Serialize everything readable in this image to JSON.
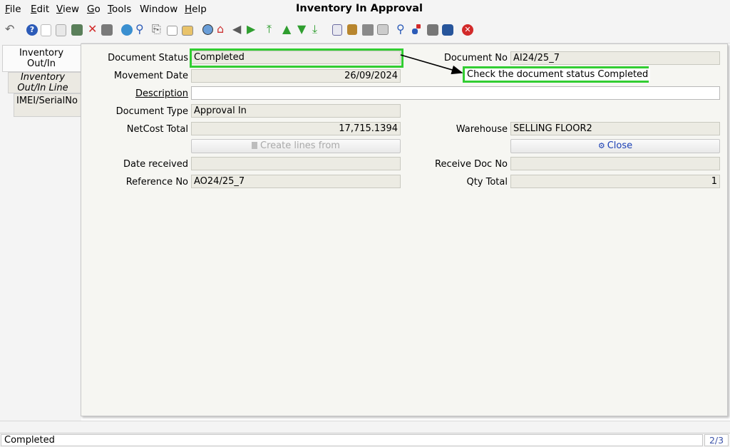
{
  "menubar": {
    "items": [
      {
        "label": "File",
        "mnemonic": "F",
        "rest": "ile"
      },
      {
        "label": "Edit",
        "mnemonic": "E",
        "rest": "dit"
      },
      {
        "label": "View",
        "mnemonic": "V",
        "rest": "iew"
      },
      {
        "label": "Go",
        "mnemonic": "G",
        "rest": "o"
      },
      {
        "label": "Tools",
        "mnemonic": "T",
        "rest": "ools"
      },
      {
        "label": "Window",
        "mnemonic": "",
        "rest": "Window"
      },
      {
        "label": "Help",
        "mnemonic": "H",
        "rest": "elp"
      }
    ],
    "title": "Inventory In Approval"
  },
  "toolbar": {
    "icons": [
      "undo-icon",
      "help-icon",
      "new-record-icon",
      "copy-record-icon",
      "delete-record-icon",
      "delete-selection-icon",
      "save-icon",
      "refresh-icon",
      "find-icon",
      "attachment-icon",
      "chat-icon",
      "multi-view-icon",
      "history-icon",
      "home-icon",
      "back-icon",
      "forward-icon",
      "first-record-icon",
      "previous-record-icon",
      "next-record-icon",
      "last-record-icon",
      "report-icon",
      "archive-icon",
      "print-icon",
      "print-preview-icon",
      "zoom-across-icon",
      "workflow-icon",
      "product-info-icon",
      "process-icon",
      "exit-icon"
    ],
    "colors": {
      "green": "#2f9e2f",
      "blue": "#2c5bb8",
      "red": "#d22a2a",
      "gray": "#7a7a7a"
    }
  },
  "tabs": [
    {
      "line1": "Inventory",
      "line2": "Out/In"
    },
    {
      "line1": "Inventory",
      "line2": "Out/In Line"
    },
    {
      "line1": "IMEI/SerialNo",
      "line2": ""
    }
  ],
  "form": {
    "document_status": {
      "label": "Document Status",
      "value": "Completed"
    },
    "movement_date": {
      "label": "Movement Date",
      "value": "26/09/2024"
    },
    "description": {
      "label": "Description",
      "value": ""
    },
    "document_type": {
      "label": "Document Type",
      "value": "Approval In"
    },
    "netcost_total": {
      "label": "NetCost Total",
      "value": "17,715.1394"
    },
    "create_lines_from": {
      "label": "Create lines from"
    },
    "date_received": {
      "label": "Date received",
      "value": ""
    },
    "reference_no": {
      "label": "Reference No",
      "value": "AO24/25_7"
    },
    "document_no": {
      "label": "Document No",
      "value": "AI24/25_7"
    },
    "warehouse": {
      "label": "Warehouse",
      "value": "SELLING FLOOR2"
    },
    "close_button": {
      "label": "Close"
    },
    "receive_doc_no": {
      "label": "Receive Doc No",
      "value": ""
    },
    "qty_total": {
      "label": "Qty Total",
      "value": "1"
    }
  },
  "annotation": {
    "text": "Check the document status Completed",
    "highlight_color": "#32cd32"
  },
  "statusbar": {
    "text": "Completed",
    "page": "2/3"
  }
}
